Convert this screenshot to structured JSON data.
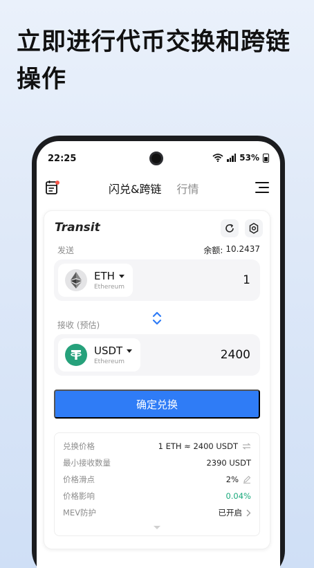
{
  "headline": "立即进行代币交换和跨链操作",
  "status_bar": {
    "time": "22:25",
    "battery": "53%"
  },
  "header": {
    "tab_active": "闪兑&跨链",
    "tab_inactive": "行情"
  },
  "card": {
    "brand": "Transit",
    "send_label": "发送",
    "balance_label": "余额:",
    "balance_value": "10.2437",
    "from_token": {
      "symbol": "ETH",
      "name": "Ethereum",
      "amount": "1"
    },
    "receive_label": "接收 (预估)",
    "to_token": {
      "symbol": "USDT",
      "name": "Ethereum",
      "amount": "2400"
    },
    "confirm_label": "确定兑换",
    "details": [
      {
        "label": "兑换价格",
        "value": "1 ETH ≈ 2400 USDT"
      },
      {
        "label": "最小接收数量",
        "value": "2390 USDT"
      },
      {
        "label": "价格滑点",
        "value": "2%"
      },
      {
        "label": "价格影响",
        "value": "0.04%"
      },
      {
        "label": "MEV防护",
        "value": "已开启"
      }
    ]
  },
  "colors": {
    "accent": "#2f7cf6",
    "green": "#19a97b",
    "tether": "#26a17b",
    "badge": "#f5564a"
  },
  "icons": [
    "wifi-icon",
    "signal-icon",
    "battery-icon",
    "document-icon",
    "menu-icon",
    "refresh-icon",
    "settings-icon",
    "eth-logo-icon",
    "usdt-logo-icon",
    "swap-direction-icon",
    "swap-price-icon",
    "edit-icon",
    "chevron-right-icon",
    "expand-caret-icon"
  ]
}
